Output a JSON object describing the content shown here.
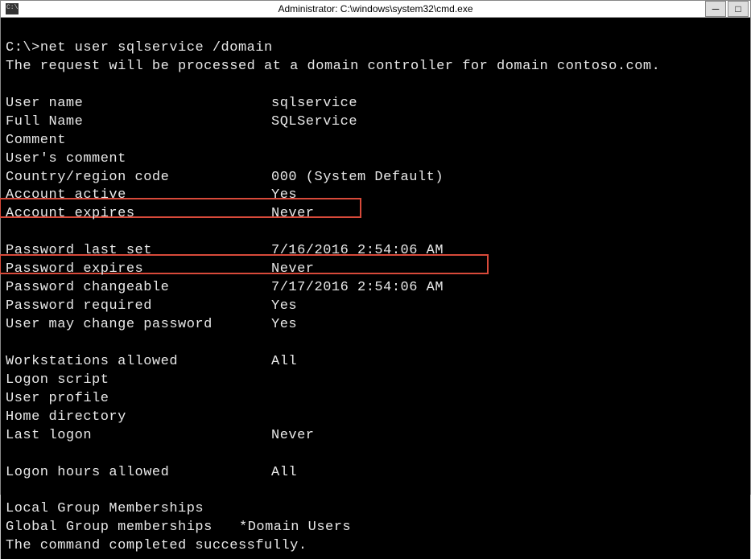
{
  "window": {
    "title": "Administrator: C:\\windows\\system32\\cmd.exe"
  },
  "prompt": {
    "prefix": "C:\\>",
    "command": "net user sqlservice /domain"
  },
  "output": {
    "processing_msg": "The request will be processed at a domain controller for domain contoso.com.",
    "fields": {
      "user_name_label": "User name",
      "user_name_value": "sqlservice",
      "full_name_label": "Full Name",
      "full_name_value": "SQLService",
      "comment_label": "Comment",
      "comment_value": "",
      "users_comment_label": "User's comment",
      "users_comment_value": "",
      "country_label": "Country/region code",
      "country_value": "000 (System Default)",
      "account_active_label": "Account active",
      "account_active_value": "Yes",
      "account_expires_label": "Account expires",
      "account_expires_value": "Never",
      "pwd_last_set_label": "Password last set",
      "pwd_last_set_value": "7/16/2016 2:54:06 AM",
      "pwd_expires_label": "Password expires",
      "pwd_expires_value": "Never",
      "pwd_changeable_label": "Password changeable",
      "pwd_changeable_value": "7/17/2016 2:54:06 AM",
      "pwd_required_label": "Password required",
      "pwd_required_value": "Yes",
      "user_may_change_label": "User may change password",
      "user_may_change_value": "Yes",
      "workstations_label": "Workstations allowed",
      "workstations_value": "All",
      "logon_script_label": "Logon script",
      "logon_script_value": "",
      "user_profile_label": "User profile",
      "user_profile_value": "",
      "home_dir_label": "Home directory",
      "home_dir_value": "",
      "last_logon_label": "Last logon",
      "last_logon_value": "Never",
      "logon_hours_label": "Logon hours allowed",
      "logon_hours_value": "All",
      "local_group_label": "Local Group Memberships",
      "local_group_value": "",
      "global_group_label": "Global Group memberships",
      "global_group_value": "*Domain Users"
    },
    "completion_msg": "The command completed successfully."
  },
  "controls": {
    "minimize": "─",
    "maximize": "□"
  }
}
